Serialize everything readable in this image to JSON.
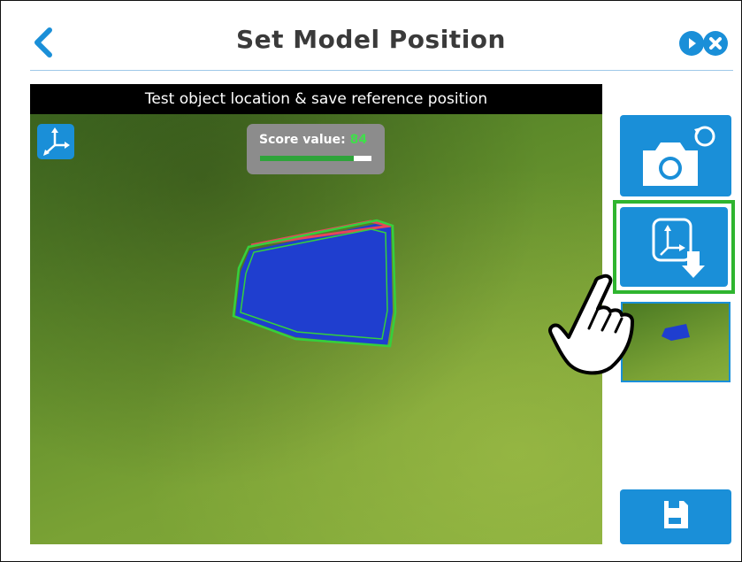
{
  "header": {
    "title": "Set Model Position"
  },
  "view": {
    "banner": "Test object location & save reference position",
    "score_label": "Score value:",
    "score_value": "84",
    "score_fraction": 0.84
  },
  "icons": {
    "back": "chevron-left-icon",
    "next": "play-circle-icon",
    "close": "close-circle-icon",
    "axis": "axis-icon",
    "camera": "camera-retake-icon",
    "save_reference": "save-reference-position-icon",
    "save": "floppy-disk-icon",
    "hand": "pointing-hand-icon"
  },
  "colors": {
    "accent": "#1a8fd8",
    "highlight": "#2fb52f",
    "score_text": "#3fe04a",
    "object": "#1f3ecf"
  }
}
